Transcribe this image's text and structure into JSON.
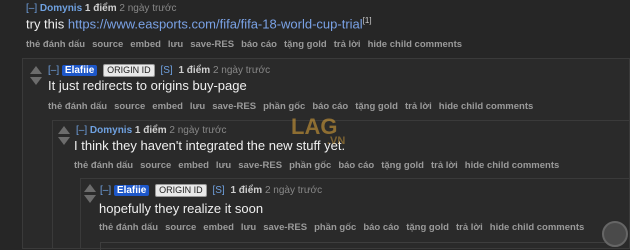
{
  "comment0": {
    "expand": "[–]",
    "user": "Domynis",
    "score": "1 điểm",
    "time": "2 ngày trước",
    "text_prefix": "try this ",
    "link": "https://www.easports.com/fifa/fifa-18-world-cup-trial",
    "sup": "[1]",
    "buttons": [
      "thẻ đánh dấu",
      "source",
      "embed",
      "lưu",
      "save-RES",
      "báo cáo",
      "tặng gold",
      "trả lời",
      "hide child comments"
    ]
  },
  "comment1": {
    "expand": "[–]",
    "user": "Elafiie",
    "flair": "ORIGIN ID",
    "s": "[S]",
    "score": "1 điểm",
    "time": "2 ngày trước",
    "text": "It just redirects to origins buy-page",
    "buttons": [
      "thẻ đánh dấu",
      "source",
      "embed",
      "lưu",
      "save-RES",
      "phần gốc",
      "báo cáo",
      "tặng gold",
      "trả lời",
      "hide child comments"
    ]
  },
  "comment2": {
    "expand": "[–]",
    "user": "Domynis",
    "score": "1 điểm",
    "time": "2 ngày trước",
    "text": "I think they haven't integrated the new stuff yet.",
    "buttons": [
      "thẻ đánh dấu",
      "source",
      "embed",
      "lưu",
      "save-RES",
      "phần gốc",
      "báo cáo",
      "tặng gold",
      "trả lời",
      "hide child comments"
    ]
  },
  "comment3": {
    "expand": "[–]",
    "user": "Elafiie",
    "flair": "ORIGIN ID",
    "s": "[S]",
    "score": "1 điểm",
    "time": "2 ngày trước",
    "text": "hopefully they realize it soon",
    "buttons": [
      "thẻ đánh dấu",
      "source",
      "embed",
      "lưu",
      "save-RES",
      "phần gốc",
      "báo cáo",
      "tặng gold",
      "trả lời",
      "hide child comments"
    ]
  },
  "watermark": {
    "top": "LAG",
    "bottom": ".VN"
  }
}
